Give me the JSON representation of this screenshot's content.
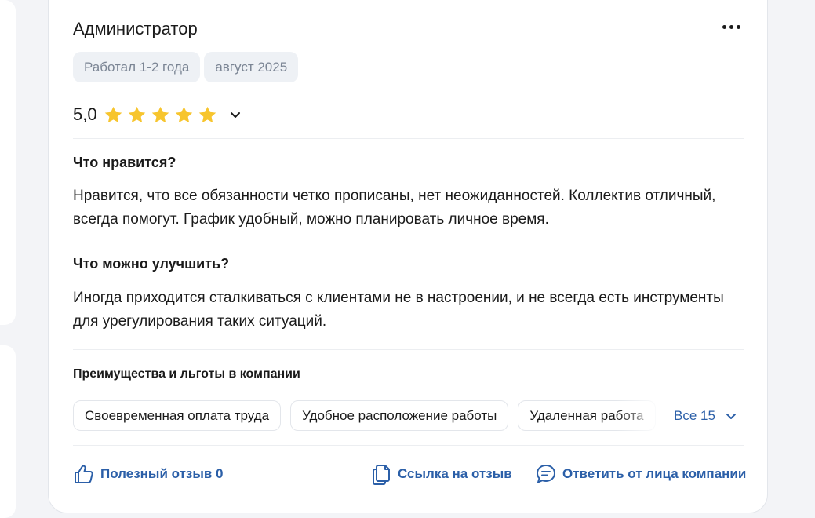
{
  "review": {
    "title": "Администратор",
    "meta_chips": [
      "Работал 1-2 года",
      "август 2025"
    ],
    "rating": "5,0",
    "stars": 5,
    "likes_heading": "Что нравится?",
    "likes_text": "Нравится, что все обязанности четко прописаны, нет неожиданностей. Коллектив отличный, всегда помогут. График удобный, можно планировать личное время.",
    "improve_heading": "Что можно улучшить?",
    "improve_text": "Иногда приходится сталкиваться с клиентами не в настроении, и не всегда есть инструменты для урегулирования таких ситуаций.",
    "benefits_heading": "Преимущества и льготы в компании",
    "benefits": [
      "Своевременная оплата труда",
      "Удобное расположение работы",
      "Удаленная работа"
    ],
    "show_all_label": "Все 15",
    "actions": {
      "helpful_label": "Полезный отзыв 0",
      "link_label": "Ссылка на отзыв",
      "reply_label": "Ответить от лица компании"
    }
  },
  "icons": {
    "star": "star-icon",
    "chevron": "chevron-down-icon",
    "more": "more-horizontal-icon",
    "thumbs_up": "thumbs-up-icon",
    "copy": "copy-icon",
    "reply": "chat-bubble-icon"
  },
  "colors": {
    "accent": "#2b5fa8",
    "star": "#f7c52e",
    "chip_bg": "#eef1f5",
    "chip_text": "#7b8594"
  }
}
